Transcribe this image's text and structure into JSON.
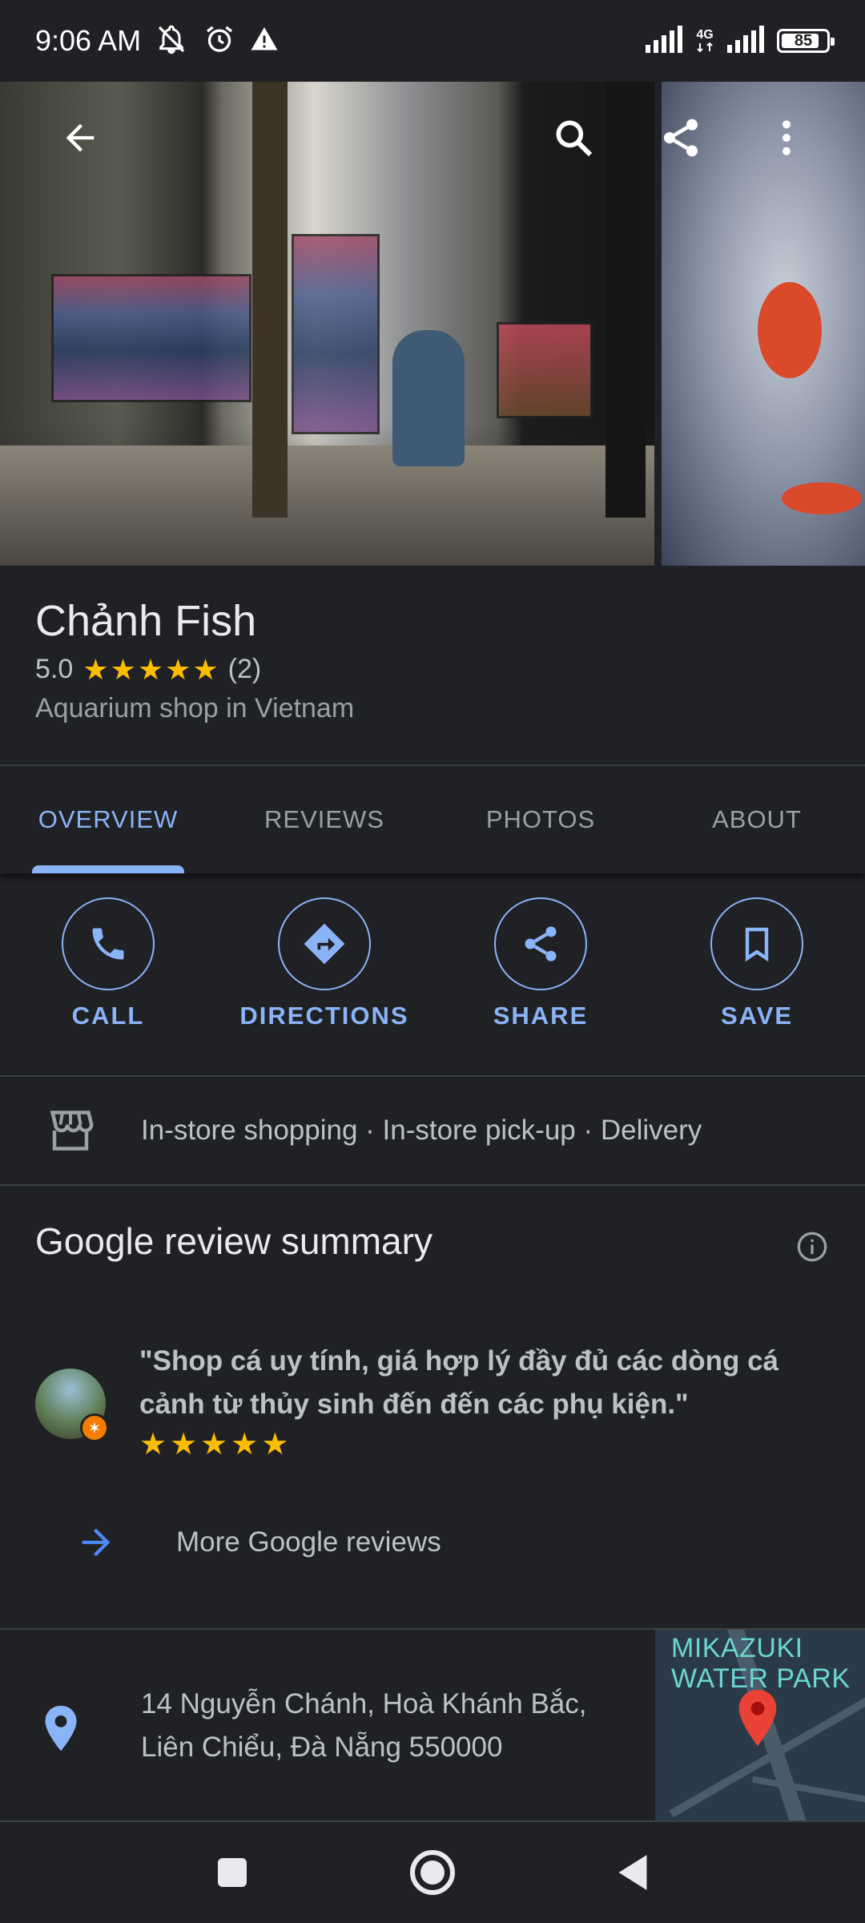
{
  "status_bar": {
    "time": "9:06 AM",
    "network": "4G",
    "battery": "85",
    "battery_level": 0.85,
    "icons": [
      "mute-icon",
      "alarm-icon",
      "warning-icon",
      "signal-icon",
      "battery-icon"
    ]
  },
  "header": {
    "icons": [
      "back-arrow-icon",
      "search-icon",
      "share-icon",
      "more-vert-icon"
    ]
  },
  "place": {
    "name": "Chảnh Fish",
    "rating": "5.0",
    "stars": 5,
    "review_count": "(2)",
    "category": "Aquarium shop in Vietnam"
  },
  "tabs": [
    {
      "label": "OVERVIEW",
      "active": true
    },
    {
      "label": "REVIEWS",
      "active": false
    },
    {
      "label": "PHOTOS",
      "active": false
    },
    {
      "label": "ABOUT",
      "active": false
    }
  ],
  "actions": [
    {
      "label": "CALL",
      "icon": "phone-icon"
    },
    {
      "label": "DIRECTIONS",
      "icon": "directions-icon"
    },
    {
      "label": "SHARE",
      "icon": "share-icon"
    },
    {
      "label": "SAVE",
      "icon": "bookmark-icon"
    }
  ],
  "services": {
    "icon": "store-icon",
    "text": "In-store shopping · In-store pick-up · Delivery"
  },
  "review_summary": {
    "title": "Google review summary",
    "quote": "\"Shop cá uy tính, giá hợp lý đầy đủ các dòng cá cảnh từ thủy sinh đến đến các phụ kiện.\"",
    "stars": 5,
    "more_label": "More Google reviews"
  },
  "address": {
    "line1": "14 Nguyễn Chánh, Hoà Khánh Bắc,",
    "line2": "Liên Chiểu, Đà Nẵng 550000",
    "map_label_1": "MIKAZUKI",
    "map_label_2": "WATER PARK"
  },
  "colors": {
    "background": "#202124",
    "accent": "#8ab4f8",
    "star": "#fbbc04",
    "text_secondary": "#bdc1c6"
  }
}
